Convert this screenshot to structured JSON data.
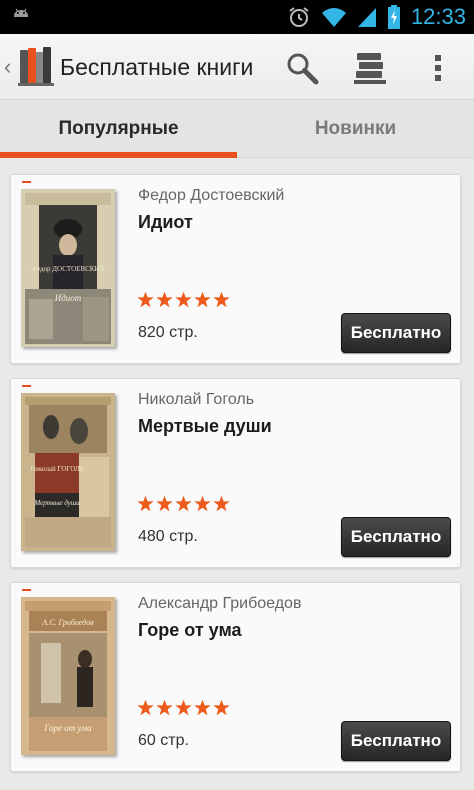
{
  "status_bar": {
    "time": "12:33",
    "icons": [
      "android-icon",
      "alarm-icon",
      "wifi-icon",
      "signal-icon",
      "battery-charging-icon"
    ],
    "time_color": "#33b5e5"
  },
  "action_bar": {
    "title": "Бесплатные книги",
    "actions": [
      "search-icon",
      "library-icon",
      "overflow-menu-icon"
    ]
  },
  "tabs": [
    {
      "label": "Популярные",
      "active": true
    },
    {
      "label": "Новинки",
      "active": false
    }
  ],
  "accent_color": "#e8501e",
  "books": [
    {
      "author": "Федор Достоевский",
      "title": "Идиот",
      "rating": 5,
      "pages": "820 стр.",
      "button": "Бесплатно",
      "cover": {
        "author": "Федор ДОСТОЕВСКИЙ",
        "title": "Идиот"
      }
    },
    {
      "author": "Николай Гоголь",
      "title": "Мертвые души",
      "rating": 5,
      "pages": "480 стр.",
      "button": "Бесплатно",
      "cover": {
        "author": "Николай ГОГОЛЬ",
        "title": "Мертвые души"
      }
    },
    {
      "author": "Александр Грибоедов",
      "title": "Горе от ума",
      "rating": 5,
      "pages": "60 стр.",
      "button": "Бесплатно",
      "cover": {
        "author": "А.С. Грибоедов",
        "title": "Горе от ума"
      }
    }
  ]
}
